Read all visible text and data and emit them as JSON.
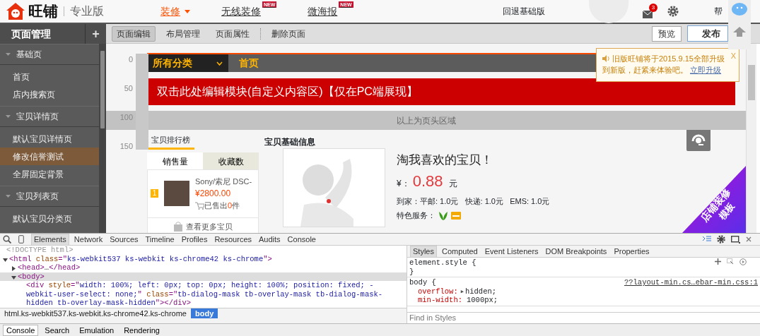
{
  "header": {
    "logo": "旺铺",
    "edition": "专业版",
    "nav": [
      {
        "label": "装修",
        "selected": true,
        "has_menu": true
      },
      {
        "label": "无线装修",
        "selected": false,
        "has_menu": false,
        "badge": "NEW"
      },
      {
        "label": "微海报",
        "selected": false,
        "has_menu": false,
        "badge": "NEW"
      }
    ],
    "fallback_link": "回退基础版",
    "mail_badge": "3",
    "help": "帮"
  },
  "sidebar": {
    "title": "页面管理",
    "add": "+",
    "sections": [
      {
        "label": "基础页",
        "expanded": true,
        "children": [
          {
            "label": "首页",
            "selected": false
          },
          {
            "label": "店内搜索页",
            "selected": false
          }
        ]
      },
      {
        "label": "宝贝详情页",
        "expanded": true,
        "children": [
          {
            "label": "默认宝贝详情页",
            "selected": false
          },
          {
            "label": "修改信誉测试",
            "selected": true
          },
          {
            "label": "全屏固定背景",
            "selected": false
          }
        ]
      },
      {
        "label": "宝贝列表页",
        "expanded": true,
        "children": [
          {
            "label": "默认宝贝分类页",
            "selected": false
          }
        ]
      }
    ]
  },
  "toolbar": {
    "tabs": [
      {
        "label": "页面编辑",
        "selected": true,
        "separator_before": false
      },
      {
        "label": "布局管理",
        "selected": false,
        "separator_before": false
      },
      {
        "label": "页面属性",
        "selected": false,
        "separator_before": false
      },
      {
        "label": "删除页面",
        "selected": false,
        "separator_before": true
      }
    ],
    "preview": "预览",
    "publish": "发布"
  },
  "canvas": {
    "ruler": [
      "0",
      "50",
      "100",
      "150"
    ],
    "category_menu": "所有分类",
    "nav_item": "首页",
    "banner": "双击此处编辑模块(自定义内容区)【仅在PC端展现】",
    "header_divider": "以上为页头区域",
    "ranking": {
      "title": "宝贝排行榜",
      "tabs": [
        {
          "label": "销售量",
          "selected": true
        },
        {
          "label": "收藏数",
          "selected": false
        }
      ],
      "items": [
        {
          "rank": "1",
          "name": "Sony/索尼 DSC-",
          "price": "¥2800.00",
          "sold_prefix": "已售出",
          "sold_count": "0",
          "sold_suffix": "件"
        }
      ],
      "more": "查看更多宝贝"
    },
    "product": {
      "heading": "宝贝基础信息",
      "title": "淘我喜欢的宝贝！",
      "currency": "¥：",
      "price": "0.88",
      "unit": "元",
      "shipping": "到家：平邮: 1.0元   快递: 1.0元   EMS: 1.0元",
      "services_label": "特色服务："
    },
    "ribbon": [
      "店铺装修",
      "模板"
    ]
  },
  "notice": {
    "text": "旧版旺铺将于2015.9.15全部升级到新版，赶紧来体验吧。",
    "link": "立即升级",
    "close": "X"
  },
  "devtools": {
    "panels": [
      {
        "label": "Elements",
        "selected": true
      },
      {
        "label": "Network",
        "selected": false
      },
      {
        "label": "Sources",
        "selected": false
      },
      {
        "label": "Timeline",
        "selected": false
      },
      {
        "label": "Profiles",
        "selected": false
      },
      {
        "label": "Resources",
        "selected": false
      },
      {
        "label": "Audits",
        "selected": false
      },
      {
        "label": "Console",
        "selected": false
      }
    ],
    "tree": [
      {
        "kind": "doctype",
        "selected": false,
        "tokens": [
          {
            "kind": "doctype",
            "text": "<!DOCTYPE html>"
          }
        ]
      },
      {
        "kind": "element",
        "expanded": true,
        "selected": false,
        "tokens": [
          {
            "kind": "tag",
            "text": "<html"
          },
          {
            "kind": "attr",
            "text": " class"
          },
          {
            "kind": "tag",
            "text": "=\""
          },
          {
            "kind": "value",
            "text": "ks-webkit537 ks-webkit ks-chrome42 ks-chrome"
          },
          {
            "kind": "tag",
            "text": "\">"
          }
        ],
        "children": [
          {
            "kind": "element",
            "expanded": false,
            "selected": false,
            "tokens": [
              {
                "kind": "tag",
                "text": "<head>"
              },
              {
                "kind": "plain",
                "text": "…"
              },
              {
                "kind": "tag",
                "text": "</head>"
              }
            ]
          },
          {
            "kind": "element",
            "expanded": true,
            "selected": true,
            "tokens": [
              {
                "kind": "tag",
                "text": "<body>"
              }
            ],
            "children": [
              {
                "kind": "leaf",
                "selected": false,
                "tokens": [
                  {
                    "kind": "tag",
                    "text": "<div"
                  },
                  {
                    "kind": "attr",
                    "text": " style"
                  },
                  {
                    "kind": "tag",
                    "text": "=\""
                  },
                  {
                    "kind": "value",
                    "text": "width: 100%; left: 0px; top: 0px; height: 100%; position: fixed; -webkit-user-select: none;"
                  },
                  {
                    "kind": "tag",
                    "text": "\""
                  },
                  {
                    "kind": "attr",
                    "text": " class"
                  },
                  {
                    "kind": "tag",
                    "text": "=\""
                  },
                  {
                    "kind": "value",
                    "text": "tb-dialog-mask tb-overlay-mask tb-dialog-mask-hidden tb-overlay-mask-hidden"
                  },
                  {
                    "kind": "tag",
                    "text": "\"></div>"
                  }
                ]
              }
            ]
          }
        ]
      }
    ],
    "breadcrumb": [
      {
        "label": "html.ks-webkit537.ks-webkit.ks-chrome42.ks-chrome",
        "selected": false
      },
      {
        "label": "body",
        "selected": true
      }
    ],
    "style_tabs": [
      {
        "label": "Styles",
        "selected": true
      },
      {
        "label": "Computed",
        "selected": false
      },
      {
        "label": "Event Listeners",
        "selected": false
      },
      {
        "label": "DOM Breakpoints",
        "selected": false
      },
      {
        "label": "Properties",
        "selected": false
      }
    ],
    "rules": [
      {
        "selector": "element.style {",
        "close": "}"
      },
      {
        "selector": "body {",
        "source": "??layout-min.cs…ebar-min.css:1",
        "declarations": [
          {
            "property": "overflow:",
            "toggle": "▶",
            "value": "hidden;"
          },
          {
            "property": "min-width:",
            "value": "1000px;"
          }
        ]
      }
    ],
    "filter_placeholder": "Find in Styles",
    "drawer_tabs": [
      {
        "label": "Console",
        "selected": true
      },
      {
        "label": "Search",
        "selected": false
      },
      {
        "label": "Emulation",
        "selected": false
      },
      {
        "label": "Rendering",
        "selected": false
      }
    ]
  }
}
